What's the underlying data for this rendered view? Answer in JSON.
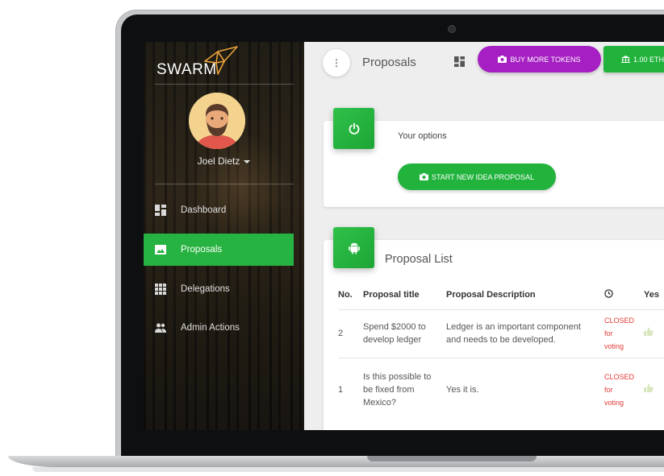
{
  "app": {
    "logo_text": "SWARM",
    "page_title": "Proposals",
    "menu_dots": "⋮"
  },
  "colors": {
    "green": "#22b33d",
    "purple": "#a51fc2",
    "closed_red": "#e53935"
  },
  "header": {
    "buy_tokens_label": "BUY MORE TOKENS",
    "eth_balance_label": "1.00 ETH"
  },
  "user": {
    "name": "Joel Dietz"
  },
  "sidebar": {
    "items": [
      {
        "label": "Dashboard",
        "icon": "dashboard-icon",
        "active": false
      },
      {
        "label": "Proposals",
        "icon": "image-icon",
        "active": true
      },
      {
        "label": "Delegations",
        "icon": "grid-icon",
        "active": false
      },
      {
        "label": "Admin Actions",
        "icon": "people-icon",
        "active": false
      }
    ]
  },
  "options_card": {
    "title": "Your options",
    "start_button_label": "START NEW IDEA PROPOSAL",
    "icon": "power-icon"
  },
  "proposal_list": {
    "title": "Proposal List",
    "icon": "android-icon",
    "columns": {
      "no": "No.",
      "title": "Proposal title",
      "description": "Proposal Description",
      "time_icon": "clock-icon",
      "yes": "Yes"
    },
    "rows": [
      {
        "no": "2",
        "title_line1": "Spend $2000 to",
        "title_line2": "develop ledger",
        "title_line3": "",
        "desc_line1": "Ledger is an important component",
        "desc_line2": "and needs to be developed.",
        "status_line1": "CLOSED",
        "status_line2": "for",
        "status_line3": "voting"
      },
      {
        "no": "1",
        "title_line1": "Is this possible to",
        "title_line2": "be fixed from",
        "title_line3": "Mexico?",
        "desc_line1": "Yes it is.",
        "desc_line2": "",
        "status_line1": "CLOSED",
        "status_line2": "for",
        "status_line3": "voting"
      }
    ]
  }
}
